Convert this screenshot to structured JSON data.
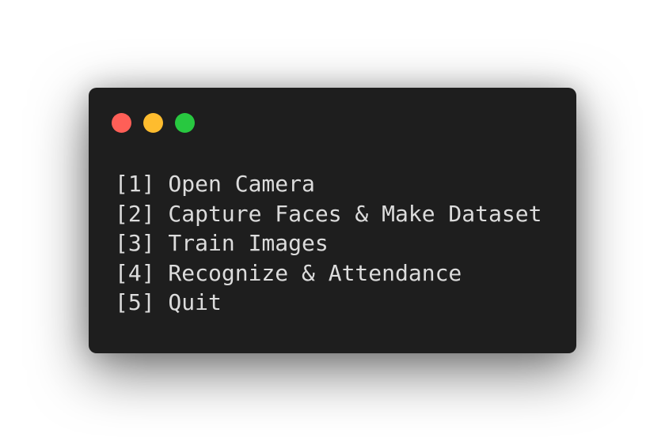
{
  "window": {
    "controls": {
      "close_color": "#ff5f57",
      "minimize_color": "#febc2e",
      "maximize_color": "#28c840"
    }
  },
  "terminal": {
    "background": "#1e1e1e",
    "text_color": "#dcdcdc",
    "lines": [
      "[1] Open Camera",
      "[2] Capture Faces & Make Dataset",
      "[3] Train Images",
      "[4] Recognize & Attendance",
      "[5] Quit"
    ]
  }
}
